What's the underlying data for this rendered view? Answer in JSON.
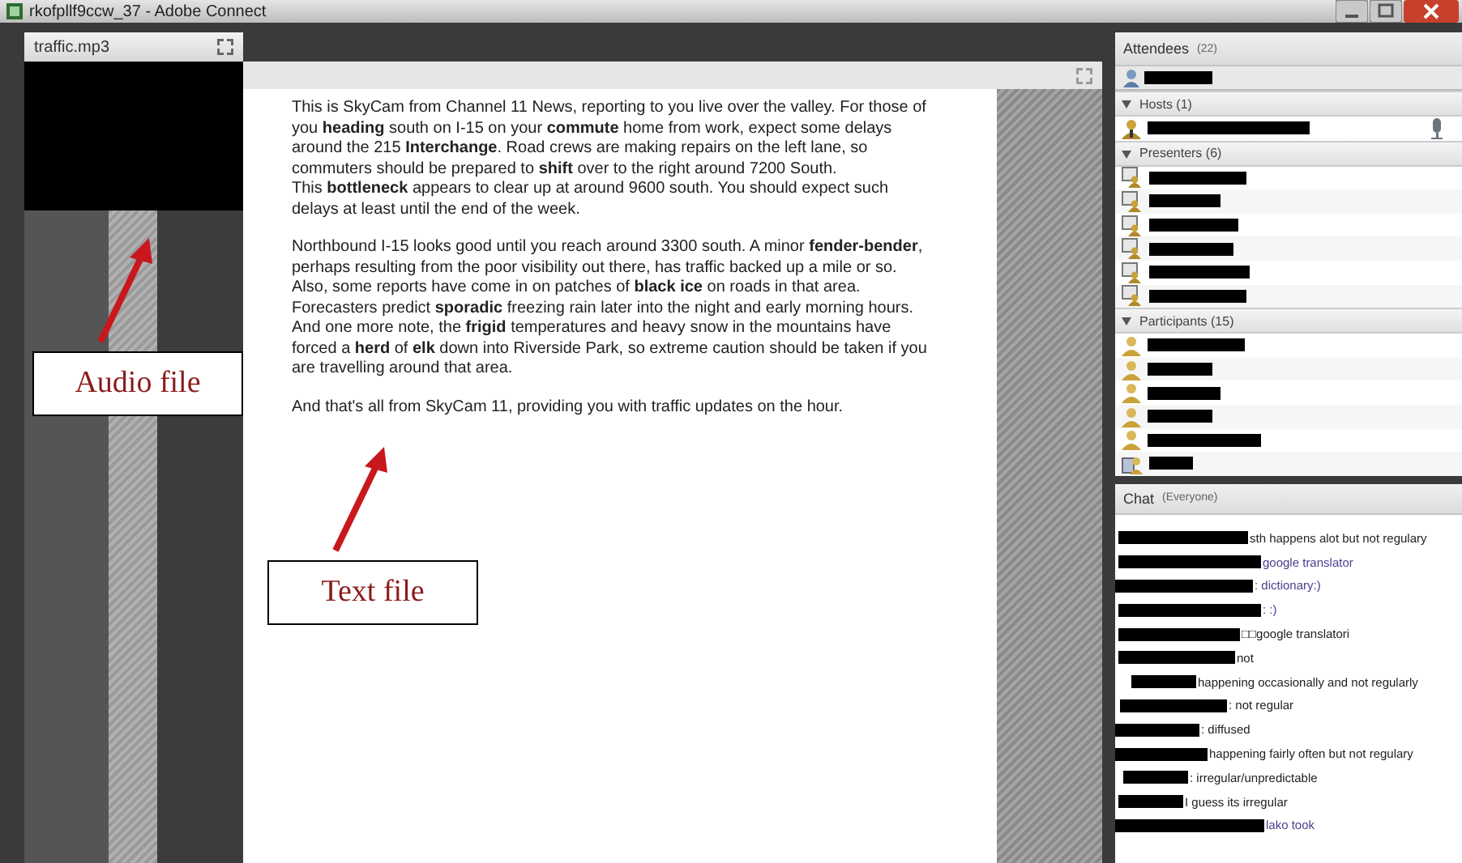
{
  "window": {
    "title": "rkofpllf9ccw_37 - Adobe Connect"
  },
  "audio_pod": {
    "title": "traffic.mp3"
  },
  "document": {
    "paragraphs": [
      {
        "lines": [
          "This is SkyCam from Channel 11 News, reporting to you live over the valley. For those of you **heading** south on I-15 on your **commute** home from work, expect some delays around the 215 **Interchange**. Road crews are making repairs on the left lane, so commuters should be prepared to **shift** over to the right around 7200 South.",
          "This **bottleneck** appears to clear up at around 9600 south. You should expect such delays at least until the end of the week."
        ]
      },
      {
        "lines": [
          "Northbound I-15 looks good until you reach around 3300 south. A minor **fender-bender**, perhaps resulting from the poor visibility out there, has traffic backed up a mile or so. Also, some reports have come in on patches of **black ice** on roads in that area. Forecasters predict **sporadic** freezing rain later into the night and early morning hours. And one more note, the **frigid** temperatures and heavy snow in the mountains have forced a **herd** of **elk** down into Riverside Park, so extreme caution should be taken if you are travelling around that area."
        ]
      },
      {
        "lines": [
          "And that's all from SkyCam 11, providing you with traffic updates on the hour."
        ]
      }
    ]
  },
  "attendees": {
    "title": "Attendees",
    "count": "(22)",
    "groups": [
      {
        "label": "Hosts (1)",
        "expanded": true,
        "members": [
          {
            "kind": "host"
          }
        ]
      },
      {
        "label": "Presenters (6)",
        "expanded": true,
        "members": [
          {
            "kind": "presenter"
          },
          {
            "kind": "presenter"
          },
          {
            "kind": "presenter"
          },
          {
            "kind": "presenter"
          },
          {
            "kind": "presenter"
          },
          {
            "kind": "presenter"
          }
        ]
      },
      {
        "label": "Participants (15)",
        "expanded": true,
        "members": [
          {
            "kind": "participant"
          },
          {
            "kind": "participant"
          },
          {
            "kind": "participant"
          },
          {
            "kind": "participant"
          },
          {
            "kind": "participant"
          },
          {
            "kind": "phone"
          }
        ]
      }
    ]
  },
  "chat": {
    "title": "Chat",
    "scope": "(Everyone)",
    "messages": [
      {
        "text": "sth happens alot but not regulary",
        "color": "#222222"
      },
      {
        "text": "google translator",
        "color": "#4a3f8f"
      },
      {
        "text": ": dictionary:)",
        "color": "#4a3f8f"
      },
      {
        "text": ": :)",
        "color": "#4a3f8f"
      },
      {
        "text": "□□google translatori",
        "color": "#222222"
      },
      {
        "text": "not",
        "color": "#222222"
      },
      {
        "text": "happening occasionally and not regularly",
        "color": "#222222"
      },
      {
        "text": ": not regular",
        "color": "#222222"
      },
      {
        "text": ": diffused",
        "color": "#222222"
      },
      {
        "text": "happening fairly often but not regulary",
        "color": "#222222"
      },
      {
        "text": ": irregular/unpredictable",
        "color": "#222222"
      },
      {
        "text": "I guess its irregular",
        "color": "#222222"
      },
      {
        "text": "lako took",
        "color": "#4a3f8f"
      }
    ]
  },
  "annotations": [
    {
      "label": "Audio file"
    },
    {
      "label": "Text file"
    }
  ]
}
